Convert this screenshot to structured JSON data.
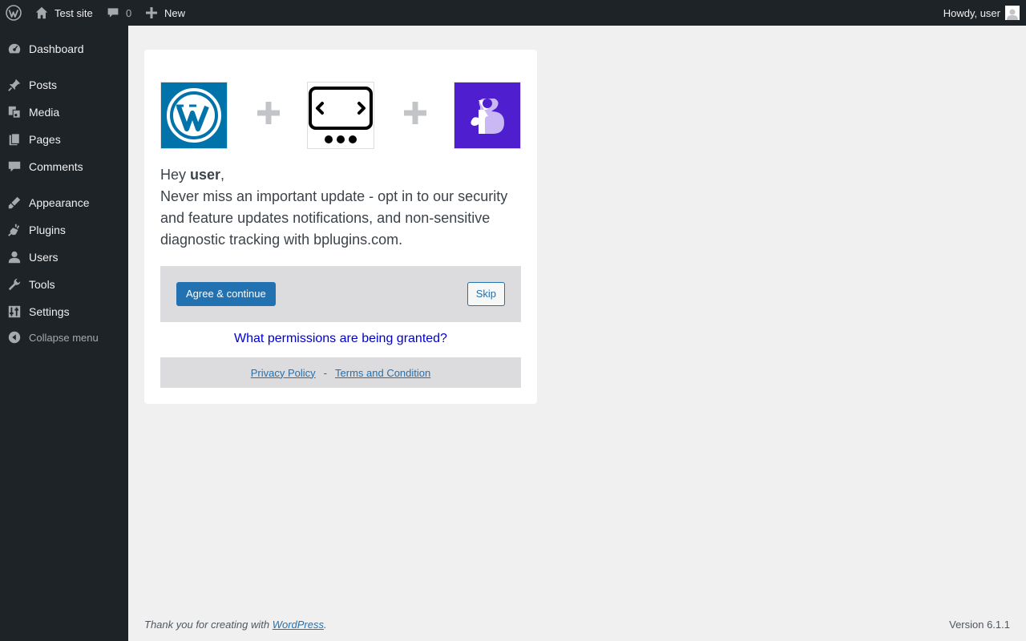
{
  "adminbar": {
    "site_name": "Test site",
    "comments_count": "0",
    "new_label": "New",
    "howdy": "Howdy, user"
  },
  "sidebar": {
    "items": [
      {
        "label": "Dashboard",
        "icon": "dashboard-icon"
      },
      {
        "label": "Posts",
        "icon": "pin-icon"
      },
      {
        "label": "Media",
        "icon": "media-icon"
      },
      {
        "label": "Pages",
        "icon": "pages-icon"
      },
      {
        "label": "Comments",
        "icon": "comment-icon"
      },
      {
        "label": "Appearance",
        "icon": "brush-icon"
      },
      {
        "label": "Plugins",
        "icon": "plugin-icon"
      },
      {
        "label": "Users",
        "icon": "user-icon"
      },
      {
        "label": "Tools",
        "icon": "wrench-icon"
      },
      {
        "label": "Settings",
        "icon": "settings-icon"
      }
    ],
    "collapse_label": "Collapse menu"
  },
  "optin": {
    "greeting_prefix": "Hey ",
    "username": "user",
    "greeting_suffix": ",",
    "message": "Never miss an important update - opt in to our security and feature updates notifications, and non-sensitive diagnostic tracking with bplugins.com.",
    "agree_label": "Agree & continue",
    "skip_label": "Skip",
    "permissions_link": "What permissions are being granted?",
    "privacy_link": "Privacy Policy",
    "separator": "-",
    "terms_link": "Terms and Condition"
  },
  "footer": {
    "thanks_prefix": "Thank you for creating with ",
    "thanks_link": "WordPress",
    "thanks_suffix": ".",
    "version": "Version 6.1.1"
  },
  "colors": {
    "adminbar_bg": "#1d2327",
    "accent": "#2271b1",
    "wp_logo_bg": "#0073aa",
    "plugin_logo_bg": "#4f1fcf",
    "page_bg": "#f0f0f1"
  }
}
